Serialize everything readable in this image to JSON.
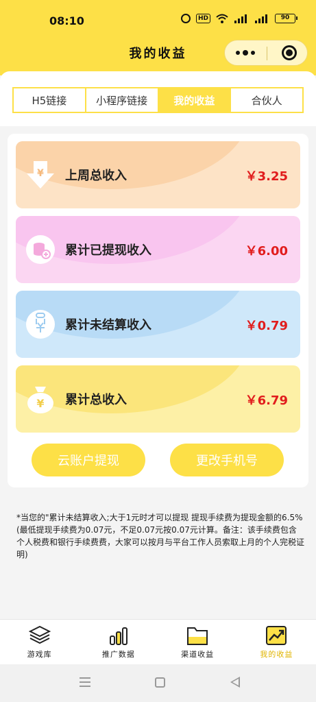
{
  "status_bar": {
    "time": "08:10",
    "hd_label": "HD",
    "battery": "90"
  },
  "header": {
    "title": "我的收益"
  },
  "tabs": [
    {
      "label": "H5链接",
      "active": false
    },
    {
      "label": "小程序链接",
      "active": false
    },
    {
      "label": "我的收益",
      "active": true
    },
    {
      "label": "合伙人",
      "active": false
    }
  ],
  "cards": [
    {
      "label": "上周总收入",
      "amount": "￥3.25",
      "icon": "download-yuan-icon"
    },
    {
      "label": "累计已提现收入",
      "amount": "￥6.00",
      "icon": "coins-plus-icon"
    },
    {
      "label": "累计未结算收入",
      "amount": "￥0.79",
      "icon": "yuan-bag-icon"
    },
    {
      "label": "累计总收入",
      "amount": "￥6.79",
      "icon": "money-bag-icon"
    }
  ],
  "buttons": {
    "withdraw": "云账户提现",
    "change_phone": "更改手机号"
  },
  "notice": "*当您的\"累计未结算收入;大于1元时才可以提现 提现手续费为提现金额的6.5%(最低提现手续费为0.07元，不足0.07元按0.07元计算。备注：该手续费包含个人税费和银行手续费费，大家可以按月与平台工作人员索取上月的个人完税证明)",
  "bottom_nav": [
    {
      "label": "游戏库",
      "icon": "layers-icon",
      "active": false
    },
    {
      "label": "推广数据",
      "icon": "bar-chart-icon",
      "active": false
    },
    {
      "label": "渠道收益",
      "icon": "folder-icon",
      "active": false
    },
    {
      "label": "我的收益",
      "icon": "trend-chart-icon",
      "active": true
    }
  ],
  "colors": {
    "accent": "#fde047",
    "amount": "#e11d1d",
    "active_nav": "#e0b400"
  }
}
